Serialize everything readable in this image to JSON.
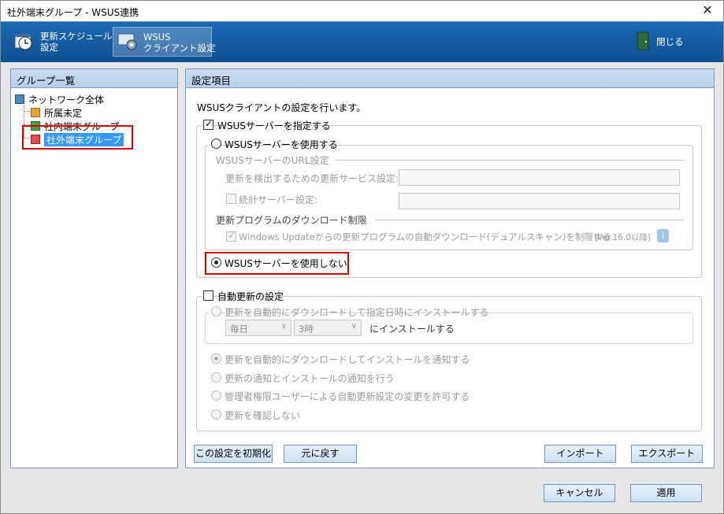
{
  "window": {
    "title": "社外端末グループ - WSUS連携"
  },
  "toolbar": {
    "schedule_line1": "更新スケジュール",
    "schedule_line2": "設定",
    "wsus_line1": "WSUS",
    "wsus_line2": "クライアント設定",
    "close_label": "閉じる"
  },
  "groups": {
    "title": "グループ一覧",
    "root": "ネットワーク全体",
    "items": [
      {
        "label": "所属未定",
        "color": "#f0a030"
      },
      {
        "label": "社内端末グループ",
        "color": "#3cab3c"
      },
      {
        "label": "社外端末グループ",
        "color": "#e84b4b"
      }
    ]
  },
  "settings": {
    "title": "設定項目",
    "description": "WSUSクライアントの設定を行います。",
    "specify_server_label": "WSUSサーバーを指定する",
    "use_server_label": "WSUSサーバーを使用する",
    "url_section_label": "WSUSサーバーのURL設定",
    "detect_url_label": "更新を検出するための更新サービス設定:",
    "stats_server_label": "統計サーバー設定:",
    "download_section_label": "更新プログラムのダウンロード制限",
    "windows_update_limit_label": "Windows Updateからの更新プログラムの自動ダウンロード(デュアルスキャン)を制限する",
    "version_note": "(Ver.16.0以降)",
    "no_server_label": "WSUSサーバーを使用しない",
    "auto_update_label": "自動更新の設定",
    "auto_install_label": "更新を自動的にダウンロードして指定日時にインストールする",
    "day_select": "毎日",
    "time_select": "3時",
    "install_suffix": "にインストールする",
    "notify_install_label": "更新を自動的にダウンロードしてインストールを通知する",
    "notify_both_label": "更新の通知とインストールの通知を行う",
    "admin_allow_label": "管理者権限ユーザーによる自動更新設定の変更を許可する",
    "no_check_label": "更新を確認しない"
  },
  "buttons": {
    "reset": "この設定を初期化",
    "revert": "元に戻す",
    "import": "インポート",
    "export": "エクスポート",
    "cancel": "キャンセル",
    "apply": "適用"
  }
}
